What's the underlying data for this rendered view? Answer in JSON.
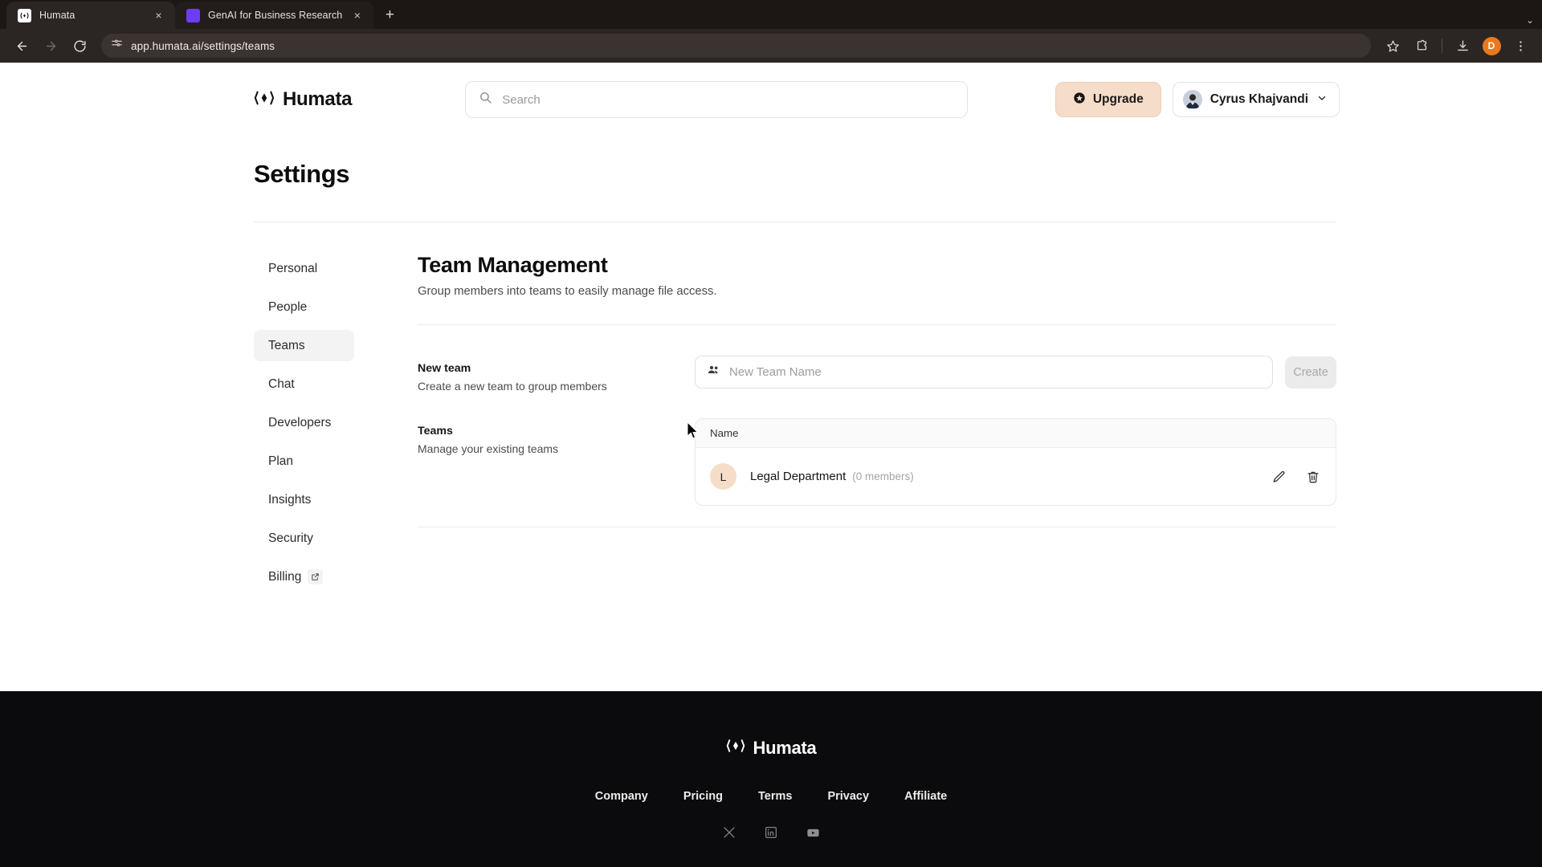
{
  "browser": {
    "tabs": [
      {
        "title": "Humata",
        "favicon": "humata-favicon",
        "active": true,
        "close_label": "×"
      },
      {
        "title": "GenAI for Business Research",
        "favicon": "genai-favicon",
        "active": false,
        "close_label": "×"
      }
    ],
    "new_tab_label": "+",
    "tabstrip_chevron": "⌄",
    "nav": {
      "back": "←",
      "forward": "→",
      "reload": "↻"
    },
    "omnibox": {
      "url": "app.humata.ai/settings/teams",
      "site_icon": "site-settings-icon"
    },
    "toolbar_icons": [
      "bookmark-star-icon",
      "extensions-icon",
      "downloads-icon",
      "browser-menu-icon"
    ],
    "profile": {
      "initial": "D",
      "color": "#e8791f"
    }
  },
  "header": {
    "logo_text": "Humata",
    "search": {
      "placeholder": "Search",
      "value": ""
    },
    "upgrade_label": "Upgrade",
    "user_name": "Cyrus Khajvandi",
    "chevron": "⌄"
  },
  "page": {
    "title": "Settings"
  },
  "sidebar": {
    "items": [
      {
        "label": "Personal",
        "active": false,
        "external": false
      },
      {
        "label": "People",
        "active": false,
        "external": false
      },
      {
        "label": "Teams",
        "active": true,
        "external": false
      },
      {
        "label": "Chat",
        "active": false,
        "external": false
      },
      {
        "label": "Developers",
        "active": false,
        "external": false
      },
      {
        "label": "Plan",
        "active": false,
        "external": false
      },
      {
        "label": "Insights",
        "active": false,
        "external": false
      },
      {
        "label": "Security",
        "active": false,
        "external": false
      },
      {
        "label": "Billing",
        "active": false,
        "external": true
      }
    ]
  },
  "main": {
    "section_title": "Team Management",
    "section_subtitle": "Group members into teams to easily manage file access.",
    "new_team": {
      "label": "New team",
      "description": "Create a new team to group members",
      "input_placeholder": "New Team Name",
      "input_value": "",
      "create_label": "Create",
      "create_disabled": true
    },
    "teams": {
      "label": "Teams",
      "description": "Manage your existing teams",
      "columns": [
        "Name"
      ],
      "rows": [
        {
          "avatar_initial": "L",
          "name": "Legal Department",
          "members": "(0 members)",
          "edit": "edit-icon",
          "delete": "delete-icon"
        }
      ]
    }
  },
  "footer": {
    "logo_text": "Humata",
    "links": [
      "Company",
      "Pricing",
      "Terms",
      "Privacy",
      "Affiliate"
    ],
    "socials": [
      "x-icon",
      "linkedin-icon",
      "youtube-icon"
    ]
  },
  "colors": {
    "accent_peach": "#f6ddc9",
    "avatar_peach": "#f5ddc8",
    "footer_bg": "#0b0b0d",
    "chrome_bg": "#2b2523"
  }
}
